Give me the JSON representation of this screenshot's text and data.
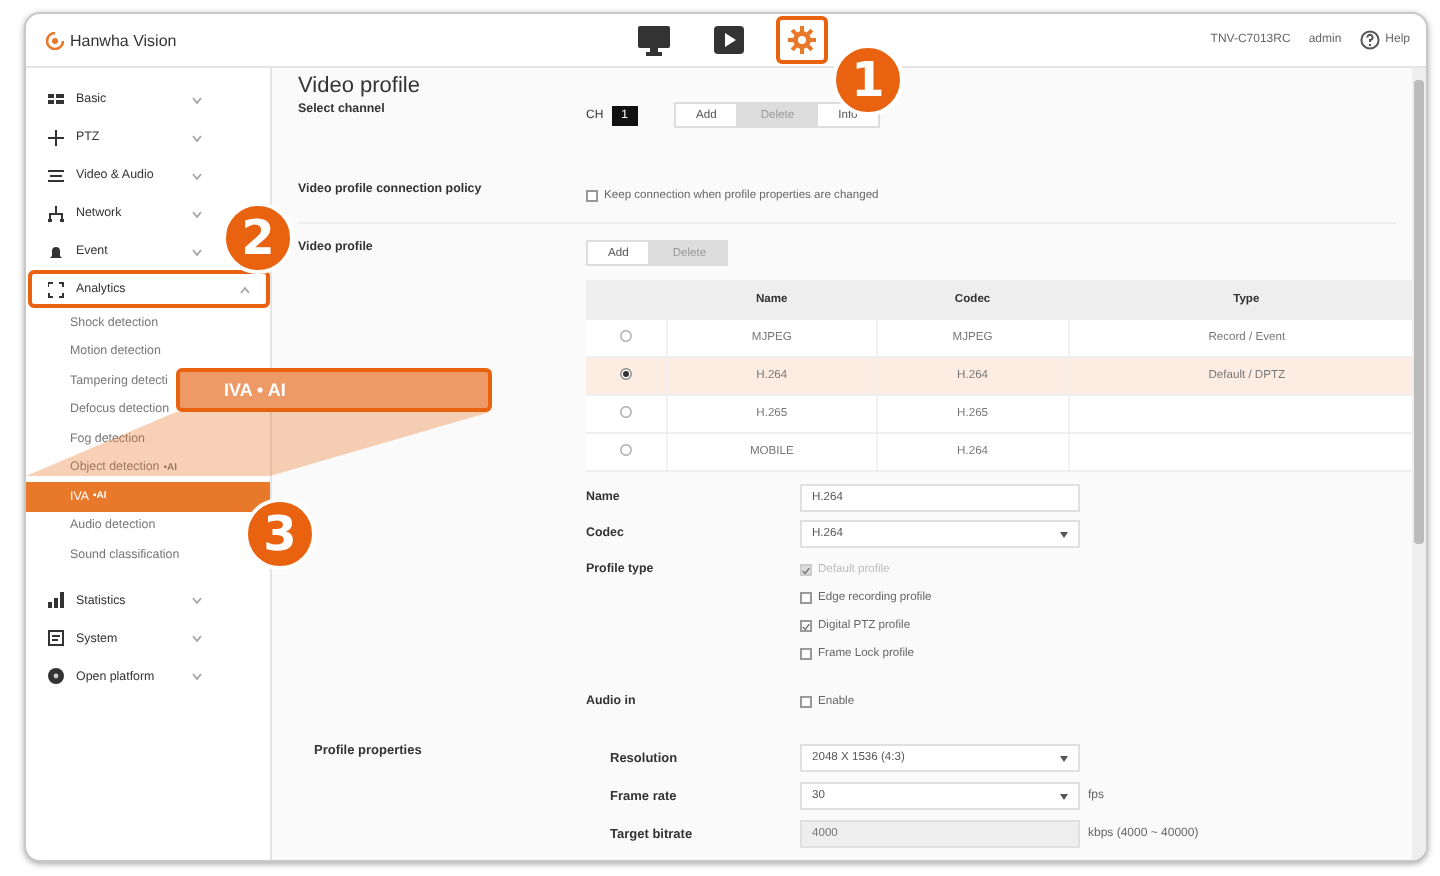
{
  "header": {
    "logo_text": "Hanwha Vision",
    "nav": [
      {
        "kind": "monitor",
        "selected": false
      },
      {
        "kind": "play",
        "selected": false
      },
      {
        "kind": "settings",
        "selected": true,
        "highlighted": true
      }
    ],
    "model": "TNV-C7013RC",
    "user": "admin",
    "help": "Help"
  },
  "sidebar": {
    "items": [
      {
        "label": "Basic",
        "expanded": false
      },
      {
        "label": "PTZ",
        "expanded": false
      },
      {
        "label": "Video & Audio",
        "expanded": false
      },
      {
        "label": "Network",
        "expanded": false
      },
      {
        "label": "Event",
        "expanded": false
      },
      {
        "label": "Analytics",
        "expanded": true,
        "highlighted": true,
        "children": [
          {
            "label": "Shock detection",
            "selected": false
          },
          {
            "label": "Motion detection",
            "selected": false
          },
          {
            "label": "Tampering detecti",
            "selected": false
          },
          {
            "label": "Defocus detection",
            "selected": false
          },
          {
            "label": "Fog detection",
            "selected": false
          },
          {
            "label": "Object detection",
            "badge": "•AI",
            "selected": false
          },
          {
            "label": "IVA",
            "badge": "•AI",
            "selected": true
          },
          {
            "label": "Audio detection",
            "selected": false
          },
          {
            "label": "Sound classification",
            "selected": false
          }
        ]
      },
      {
        "label": "Statistics",
        "expanded": false
      },
      {
        "label": "System",
        "expanded": false
      },
      {
        "label": "Open platform",
        "expanded": false
      }
    ]
  },
  "content": {
    "title": "Video profile",
    "select_channel": {
      "label": "Select channel",
      "prefix": "CH",
      "channel": "1",
      "buttons": [
        {
          "label": "Add",
          "disabled": false
        },
        {
          "label": "Delete",
          "disabled": true
        },
        {
          "label": "Info",
          "disabled": false
        }
      ]
    },
    "connection_policy": {
      "label": "Video profile connection policy",
      "option": {
        "label": "Keep connection when profile properties are changed",
        "checked": false
      }
    },
    "video_profile": {
      "label": "Video profile",
      "buttons": [
        {
          "label": "Add",
          "disabled": false
        },
        {
          "label": "Delete",
          "disabled": true
        }
      ],
      "table": {
        "columns": [
          "Name",
          "Codec",
          "Type"
        ],
        "rows": [
          {
            "selected": false,
            "name": "MJPEG",
            "codec": "MJPEG",
            "type": "Record / Event"
          },
          {
            "selected": true,
            "name": "H.264",
            "codec": "H.264",
            "type": "Default / DPTZ"
          },
          {
            "selected": false,
            "name": "H.265",
            "codec": "H.265",
            "type": ""
          },
          {
            "selected": false,
            "name": "MOBILE",
            "codec": "H.264",
            "type": ""
          }
        ]
      },
      "form": [
        {
          "kind": "input",
          "label": "Name",
          "value": "H.264"
        },
        {
          "kind": "select",
          "label": "Codec",
          "value": "H.264"
        },
        {
          "kind": "checks",
          "label": "Profile type",
          "options": [
            {
              "label": "Default profile",
              "checked": true,
              "disabled": true
            },
            {
              "label": "Edge recording profile",
              "checked": false,
              "disabled": false
            },
            {
              "label": "Digital PTZ profile",
              "checked": true,
              "disabled": false
            },
            {
              "label": "Frame Lock profile",
              "checked": false,
              "disabled": false
            }
          ]
        },
        {
          "kind": "checks",
          "label": "Audio in",
          "options": [
            {
              "label": "Enable",
              "checked": false,
              "disabled": false
            }
          ]
        }
      ]
    },
    "profile_properties": {
      "label": "Profile properties",
      "fields": [
        {
          "kind": "select",
          "label": "Resolution",
          "value": "2048 X 1536 (4:3)",
          "disabled": false
        },
        {
          "kind": "select",
          "label": "Frame rate",
          "value": "30",
          "unit": "fps",
          "disabled": false
        },
        {
          "kind": "input",
          "label": "Target bitrate",
          "placeholder": "4000",
          "unit": "kbps (4000 ~ 40000)",
          "disabled": true
        }
      ]
    }
  },
  "callouts": {
    "numbers": [
      "1",
      "2",
      "3"
    ],
    "label": "IVA • AI"
  }
}
